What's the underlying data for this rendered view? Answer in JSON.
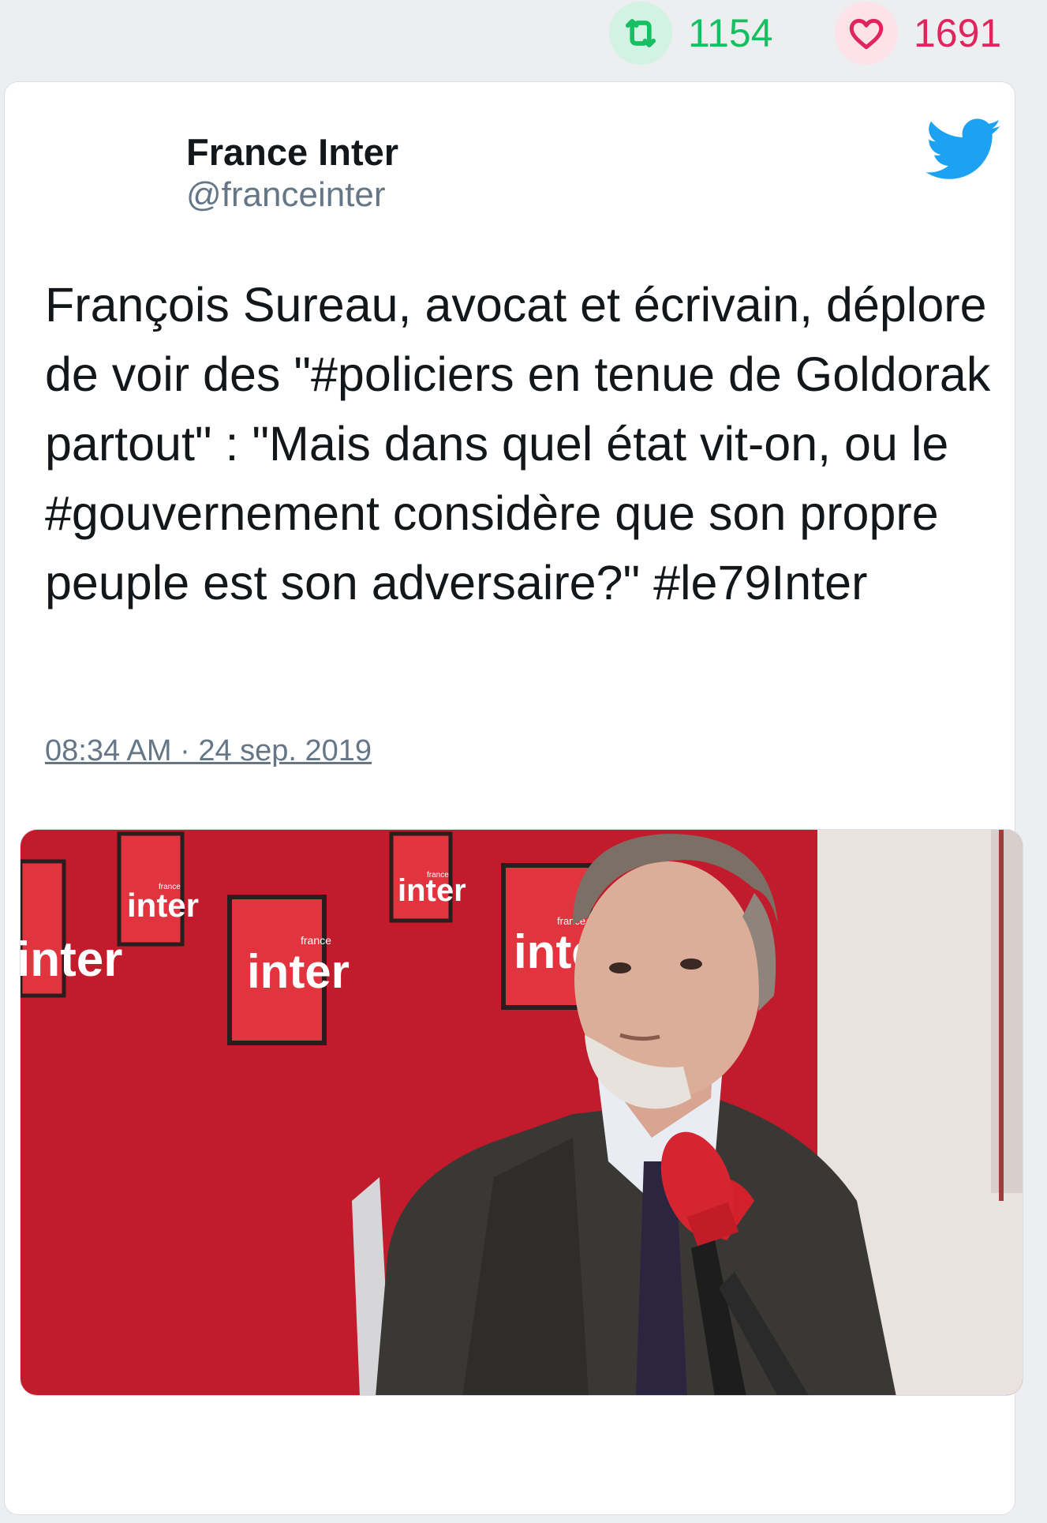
{
  "stats": {
    "retweets": "1154",
    "likes": "1691",
    "retweet_icon": "retweet-icon",
    "like_icon": "heart-icon",
    "retweet_color": "#17bf63",
    "like_color": "#e0245e"
  },
  "tweet": {
    "author_name": "France Inter",
    "author_handle": "@franceinter",
    "text": "François Sureau, avocat et écrivain, déplore de voir des \"#policiers en tenue de Goldorak partout\" : \"Mais dans quel état vit-on, ou le #gouvernement considère que son propre peuple est son adversaire?\" #le79Inter",
    "timestamp": "08:34 AM · 24 sep. 2019",
    "brand_icon": "twitter-bird-icon",
    "brand_color": "#1da1f2"
  },
  "actions": [
    {
      "icon": "reply-icon"
    },
    {
      "icon": "retweet-icon"
    },
    {
      "icon": "like-icon"
    }
  ],
  "media": {
    "logo_top": "france",
    "logo_main": "inter"
  }
}
